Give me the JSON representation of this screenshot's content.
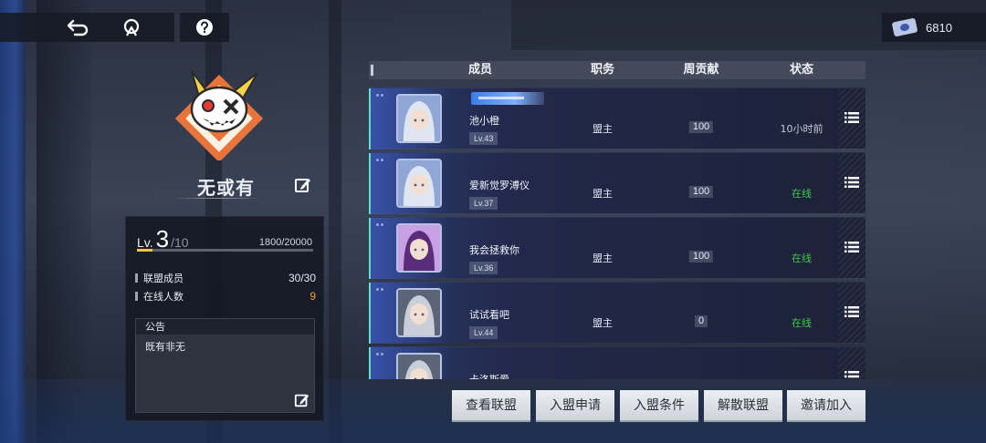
{
  "currency": {
    "amount": "6810",
    "icon": "ticket-icon"
  },
  "guild": {
    "name": "无或有",
    "level_prefix": "Lv.",
    "level": "3",
    "level_max": "/10",
    "exp_current": "1800",
    "exp_total": "/20000",
    "exp_fraction": 0.09,
    "members_label": "联盟成员",
    "members_value": "30/30",
    "online_label": "在线人数",
    "online_value": "9",
    "notice_title": "公告",
    "notice_text": "既有非无"
  },
  "table": {
    "headers": {
      "member": "成员",
      "role": "职务",
      "weekly": "周贡献",
      "status": "状态"
    },
    "rows": [
      {
        "name": "池小橙",
        "level": "Lv.43",
        "role": "盟主",
        "weekly": "100",
        "status": "10小时前",
        "online": false,
        "has_title": true,
        "avatar": "silver-hair-girl"
      },
      {
        "name": "爱新觉罗溥仪",
        "level": "Lv.37",
        "role": "盟主",
        "weekly": "100",
        "status": "在线",
        "online": true,
        "has_title": false,
        "avatar": "silver-hair-girl"
      },
      {
        "name": "我会拯救你",
        "level": "Lv.36",
        "role": "盟主",
        "weekly": "100",
        "status": "在线",
        "online": true,
        "has_title": false,
        "avatar": "purple-hair-girl"
      },
      {
        "name": "试试看吧",
        "level": "Lv.44",
        "role": "盟主",
        "weekly": "0",
        "status": "在线",
        "online": true,
        "has_title": false,
        "avatar": "silver-hair-boy"
      },
      {
        "name": "卡洛斯爱",
        "level": "",
        "role": "",
        "weekly": "",
        "status": "",
        "online": false,
        "has_title": false,
        "avatar": "silver-hair-boy"
      }
    ]
  },
  "buttons": {
    "view": "查看联盟",
    "apply": "入盟申请",
    "conditions": "入盟条件",
    "disband": "解散联盟",
    "invite": "邀请加入"
  },
  "colors": {
    "online": "#3ec94a",
    "weekly_online": "#f0a030",
    "accent": "#5de0c8"
  }
}
